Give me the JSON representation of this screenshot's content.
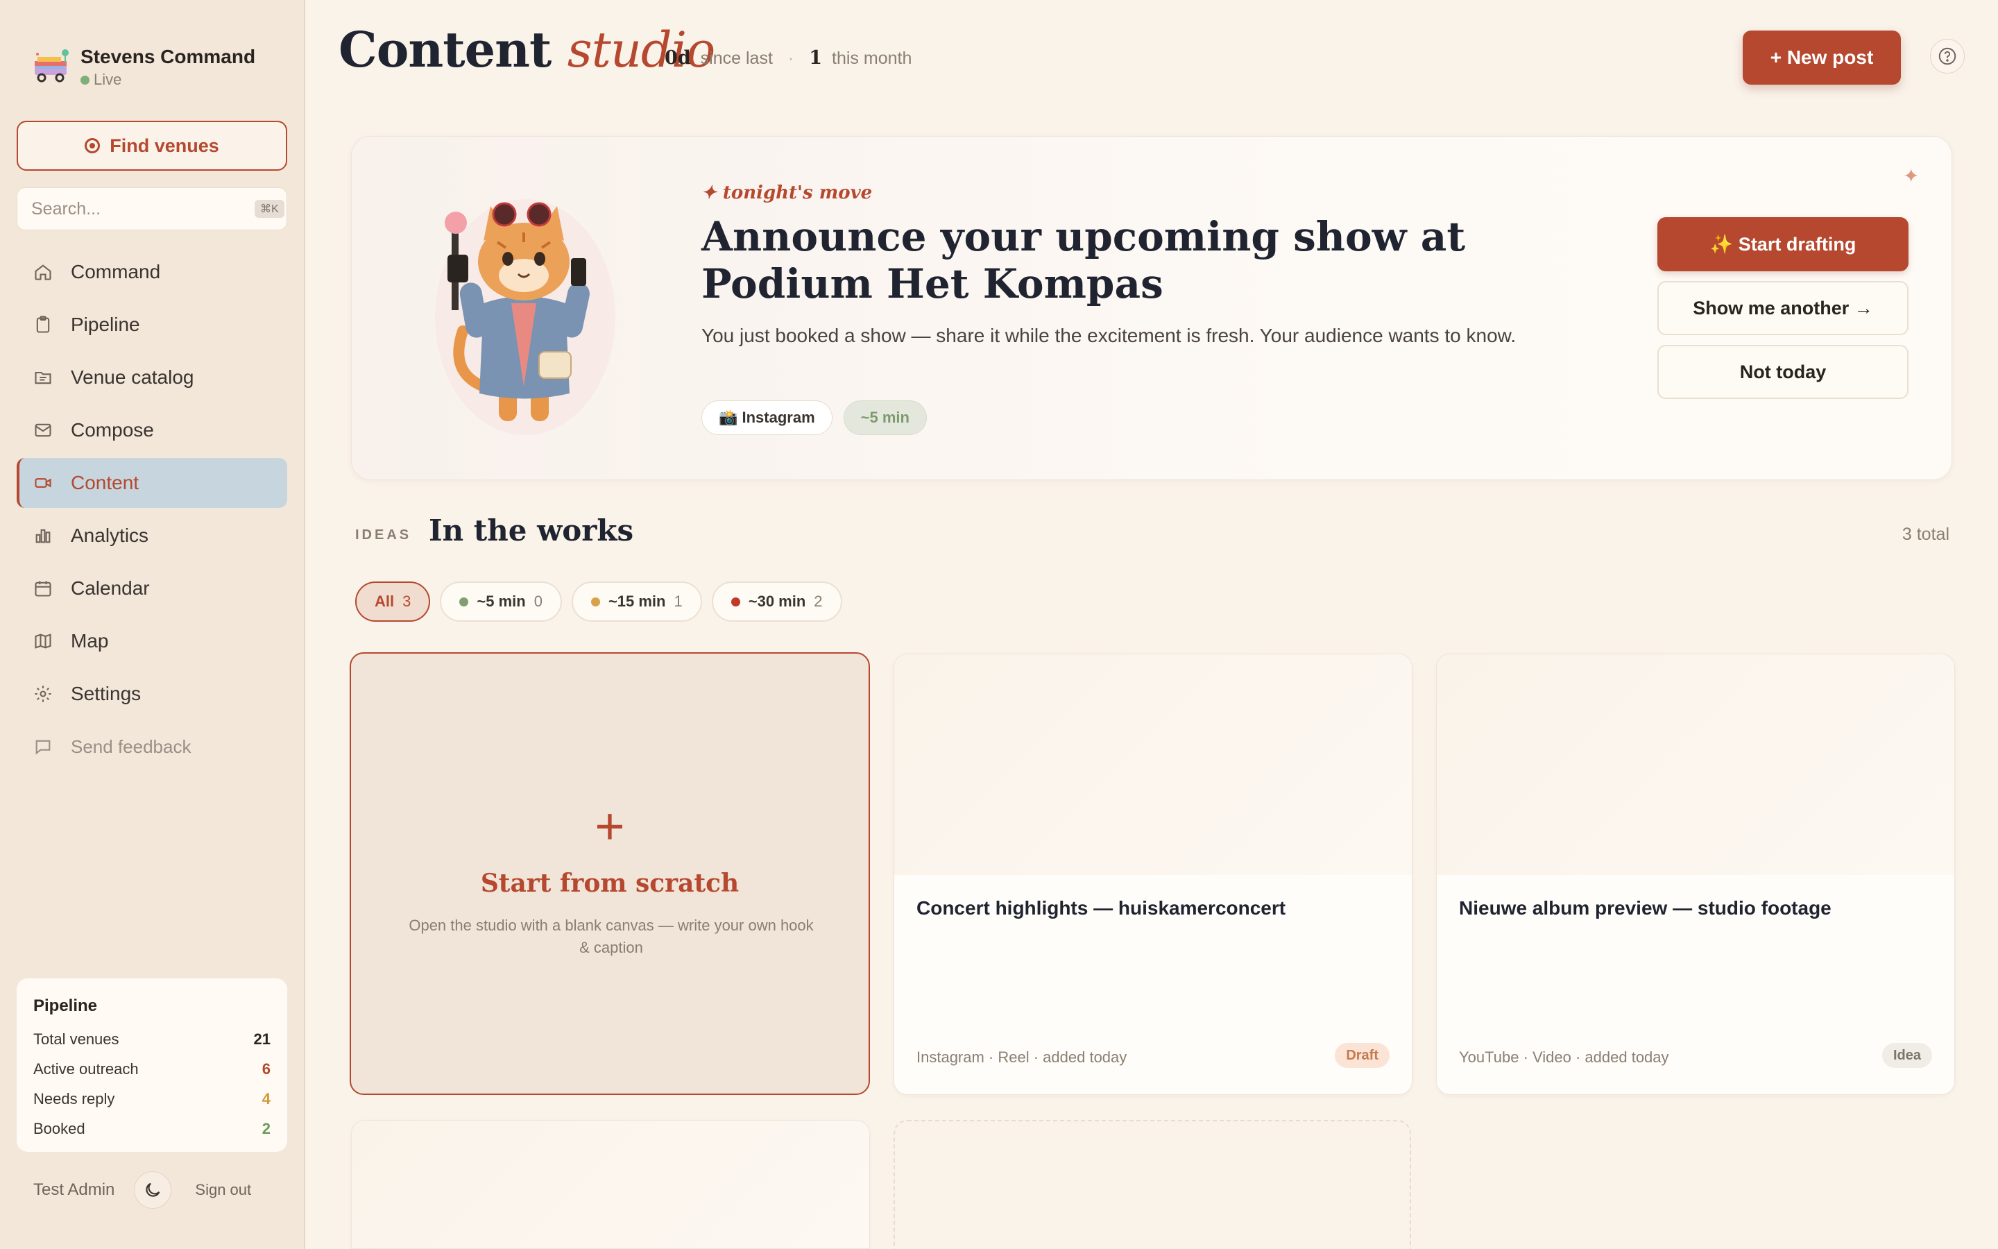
{
  "brand": {
    "name": "Stevens Command",
    "status": "Live"
  },
  "sidebar": {
    "find_venues": "Find venues",
    "search_placeholder": "Search...",
    "search_shortcut": "⌘K",
    "nav": [
      {
        "label": "Command",
        "icon": "home-icon"
      },
      {
        "label": "Pipeline",
        "icon": "clipboard-icon"
      },
      {
        "label": "Venue catalog",
        "icon": "folder-list-icon"
      },
      {
        "label": "Compose",
        "icon": "mail-icon"
      },
      {
        "label": "Content",
        "icon": "video-camera-icon",
        "active": true
      },
      {
        "label": "Analytics",
        "icon": "bar-chart-icon"
      },
      {
        "label": "Calendar",
        "icon": "calendar-icon"
      },
      {
        "label": "Map",
        "icon": "map-icon"
      },
      {
        "label": "Settings",
        "icon": "gear-icon"
      },
      {
        "label": "Send feedback",
        "icon": "chat-bubble-icon"
      }
    ],
    "pipeline": {
      "title": "Pipeline",
      "rows": [
        {
          "label": "Total venues",
          "value": "21",
          "color": "#2a2420"
        },
        {
          "label": "Active outreach",
          "value": "6",
          "color": "#b5482f"
        },
        {
          "label": "Needs reply",
          "value": "4",
          "color": "#d29a3a"
        },
        {
          "label": "Booked",
          "value": "2",
          "color": "#6e9a5e"
        }
      ]
    },
    "user": "Test Admin",
    "sign_out": "Sign out"
  },
  "header": {
    "title_main": "Content",
    "title_accent": "studio",
    "stat_since_value": "0d",
    "stat_since_label": "since last",
    "stat_month_value": "1",
    "stat_month_label": "this month",
    "new_post": "+ New post"
  },
  "hero": {
    "kicker": "✦ tonight's move",
    "title": "Announce your upcoming show at Podium Het Kompas",
    "description": "You just booked a show — share it while the excitement is fresh. Your audience wants to know.",
    "platform": "📸 Instagram",
    "time": "~5 min",
    "primary": "✨ Start drafting",
    "secondary": "Show me another →",
    "dismiss": "Not today"
  },
  "ideas": {
    "kicker": "IDEAS",
    "title": "In the works",
    "total": "3 total",
    "filters": [
      {
        "label": "All",
        "count": "3",
        "active": true
      },
      {
        "label": "~5 min",
        "count": "0",
        "dot": "#7fa06e"
      },
      {
        "label": "~15 min",
        "count": "1",
        "dot": "#d9a24a"
      },
      {
        "label": "~30 min",
        "count": "2",
        "dot": "#c0392b"
      }
    ],
    "scratch": {
      "plus": "+",
      "title": "Start from scratch",
      "description": "Open the studio with a blank canvas — write your own hook & caption"
    },
    "cards": [
      {
        "title": "Concert highlights — huiskamerconcert",
        "meta": "Instagram · Reel · added today",
        "badge": "Draft"
      },
      {
        "title": "Nieuwe album preview — studio footage",
        "meta": "YouTube · Video · added today",
        "badge": "Idea"
      }
    ]
  }
}
